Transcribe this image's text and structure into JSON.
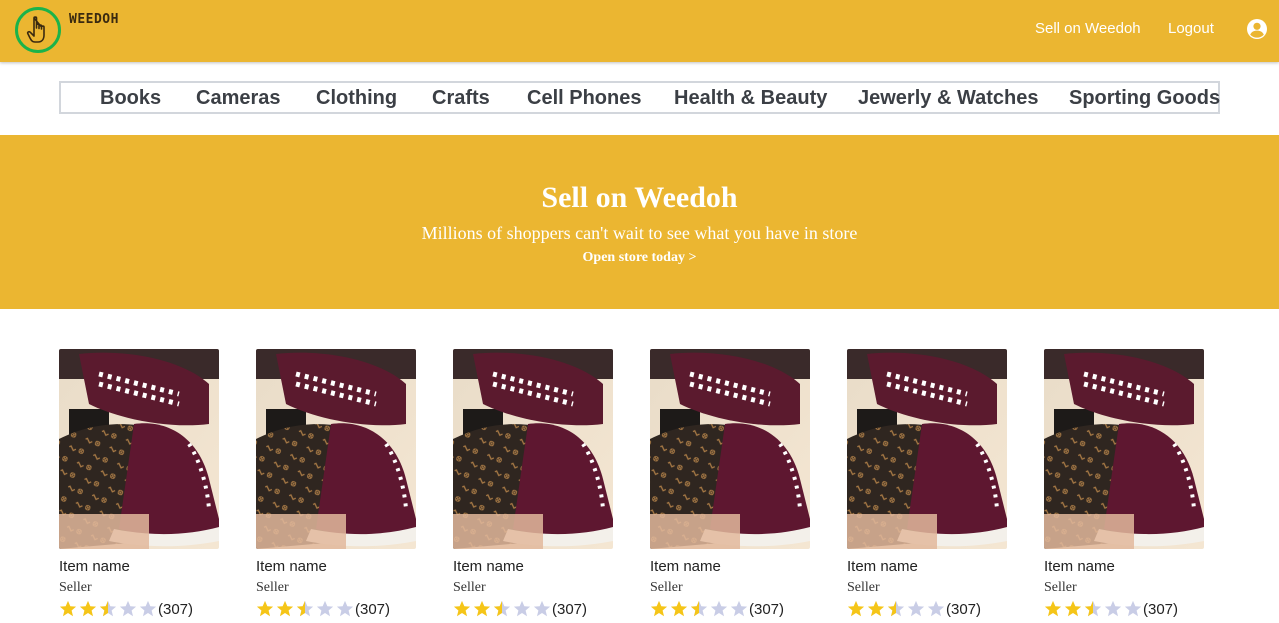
{
  "header": {
    "logo_text": "WEEDOH",
    "sell_link": "Sell on Weedoh",
    "logout_link": "Logout",
    "user_icon": "user-circle-icon",
    "logo_icon": "pointing-hand-icon"
  },
  "categories": [
    "Books",
    "Cameras",
    "Clothing",
    "Crafts",
    "Cell Phones",
    "Health & Beauty",
    "Jewerly & Watches",
    "Sporting Goods"
  ],
  "banner": {
    "title": "Sell on Weedoh",
    "subtitle": "Millions of shoppers can't wait to see what you have in store",
    "cta": "Open store today >"
  },
  "products": [
    {
      "name": "Item name",
      "seller": "Seller",
      "rating": 2.5,
      "rating_count": "(307)"
    },
    {
      "name": "Item name",
      "seller": "Seller",
      "rating": 2.5,
      "rating_count": "(307)"
    },
    {
      "name": "Item name",
      "seller": "Seller",
      "rating": 2.5,
      "rating_count": "(307)"
    },
    {
      "name": "Item name",
      "seller": "Seller",
      "rating": 2.5,
      "rating_count": "(307)"
    },
    {
      "name": "Item name",
      "seller": "Seller",
      "rating": 2.5,
      "rating_count": "(307)"
    },
    {
      "name": "Item name",
      "seller": "Seller",
      "rating": 2.5,
      "rating_count": "(307)"
    }
  ],
  "colors": {
    "brand": "#ebb631",
    "logo_ring": "#1bb34a",
    "star_filled": "#f5c518",
    "star_empty": "#c9cde6",
    "nav_text": "#3b3f45"
  }
}
